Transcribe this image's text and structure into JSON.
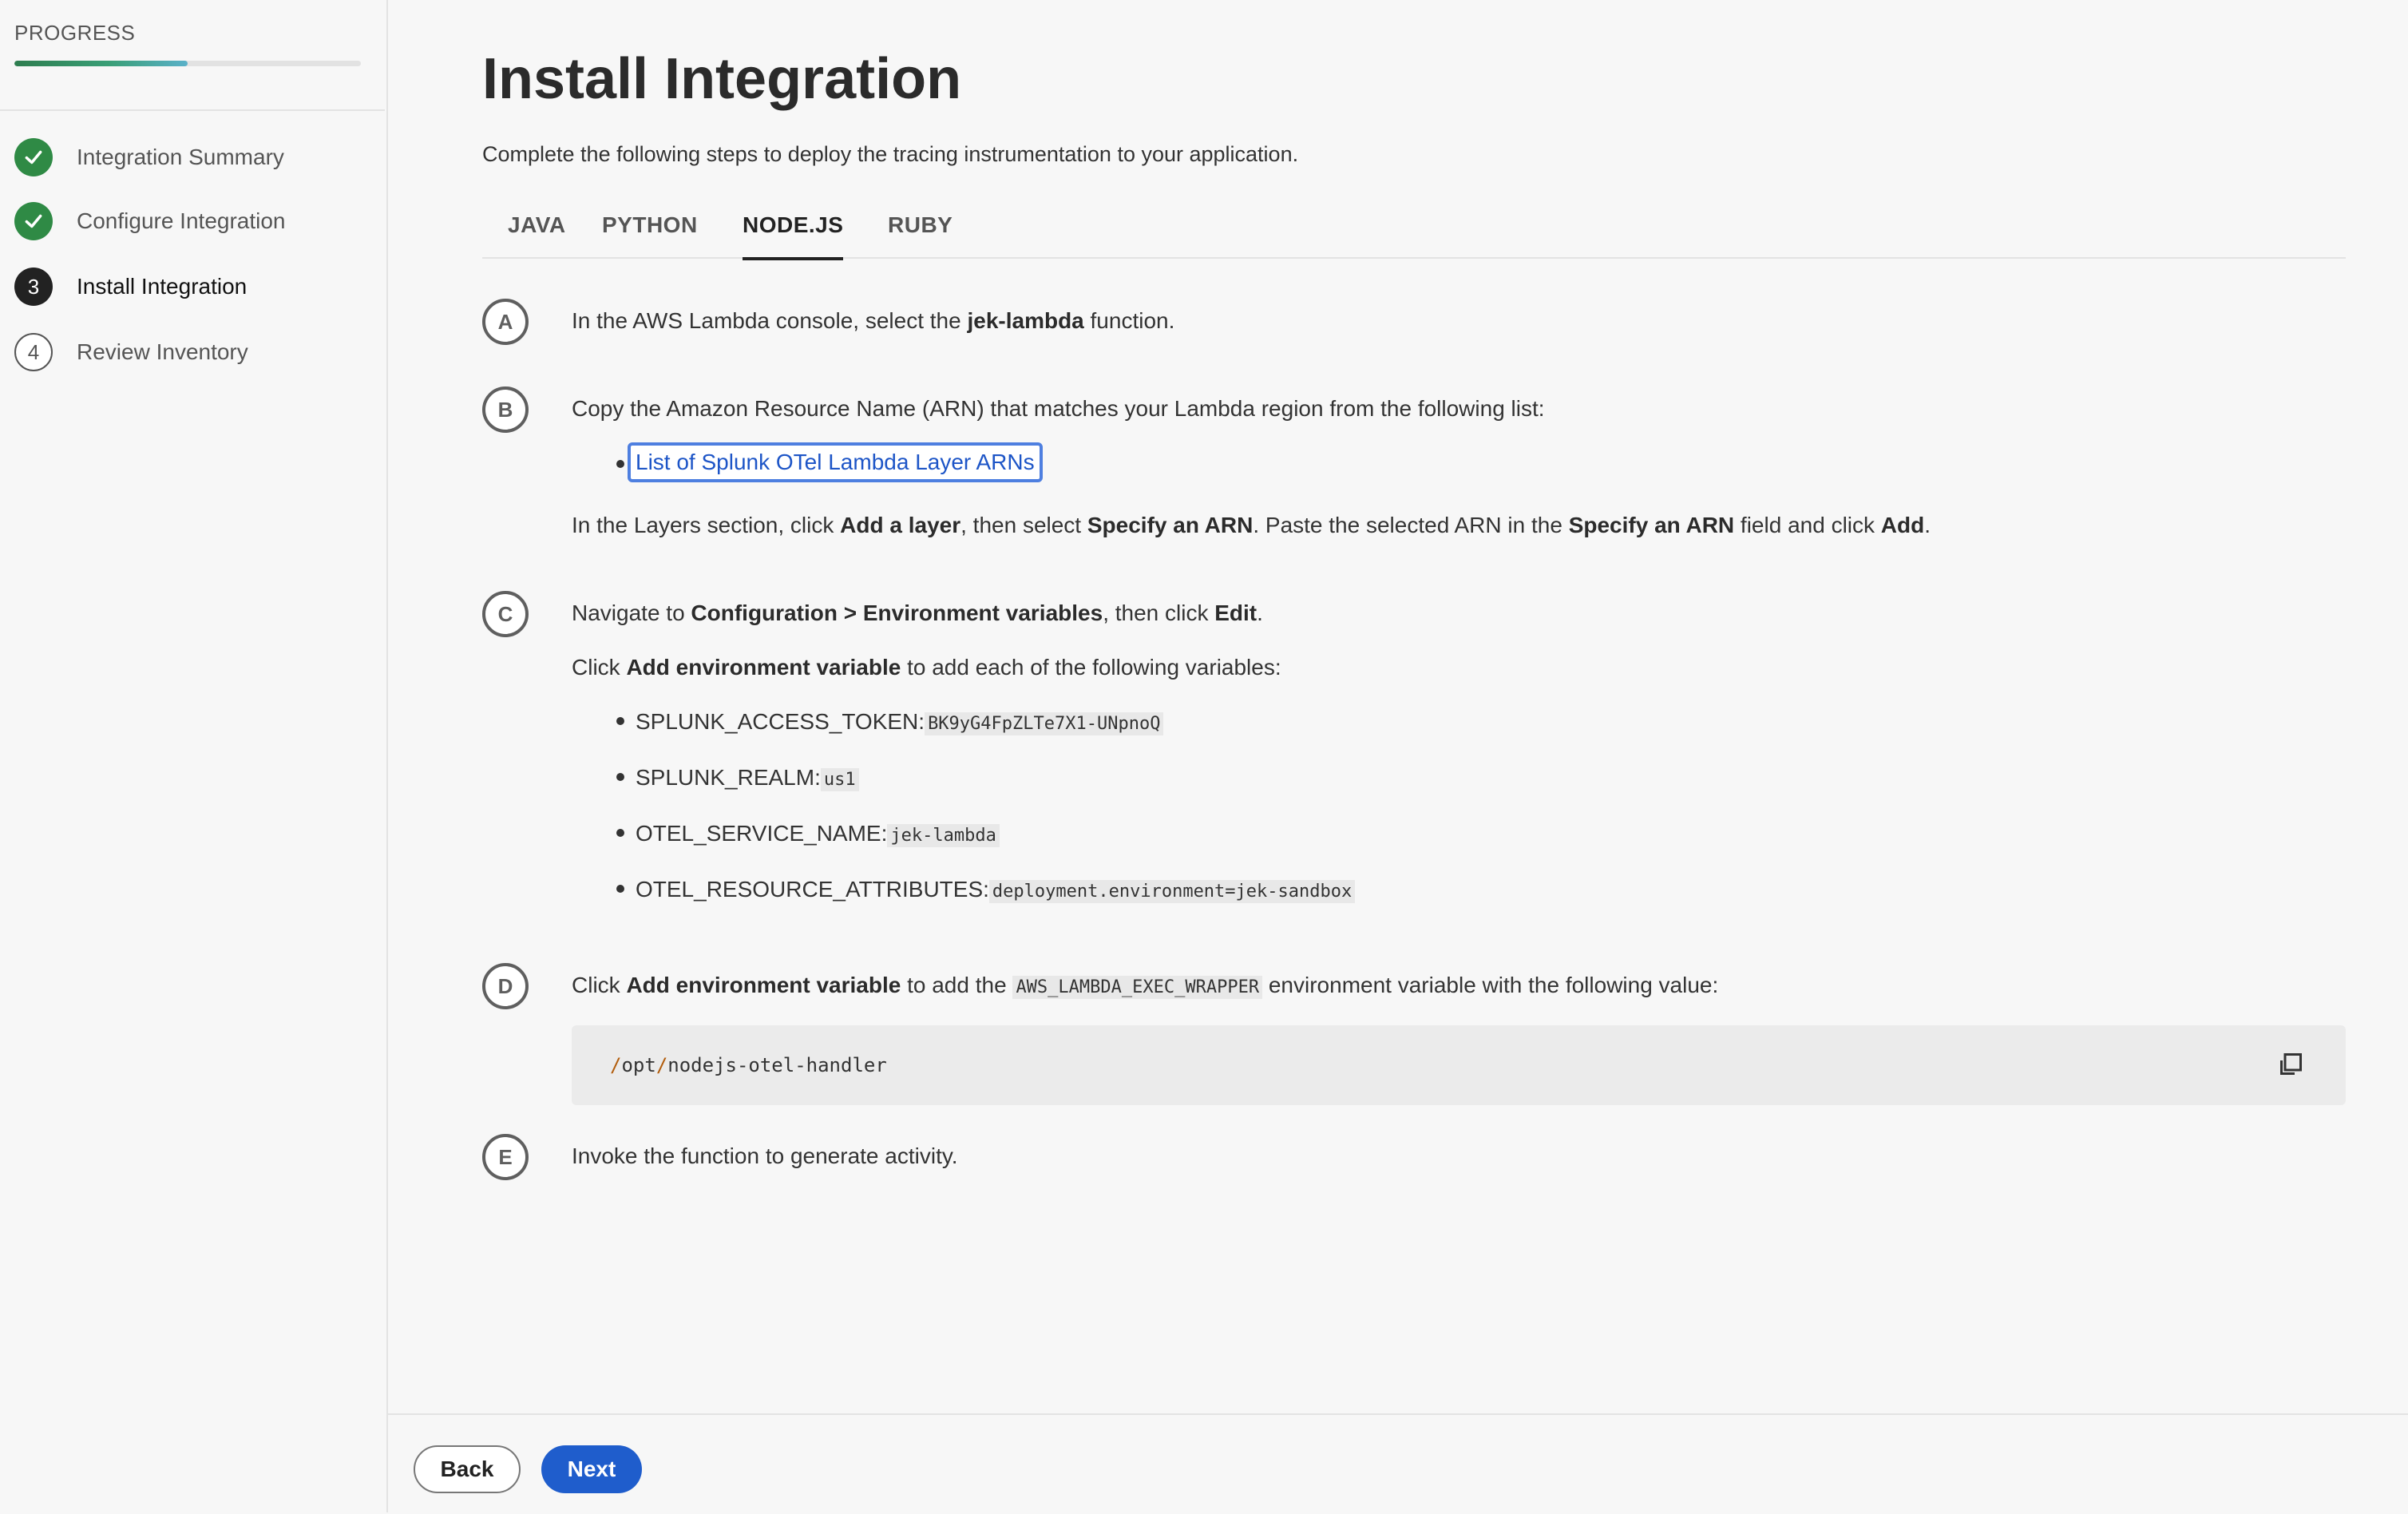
{
  "sidebar": {
    "progress_label": "PROGRESS",
    "progress_fraction": 0.5,
    "steps": [
      {
        "label": "Integration Summary",
        "state": "done"
      },
      {
        "label": "Configure Integration",
        "state": "done"
      },
      {
        "label": "Install Integration",
        "state": "current",
        "number": "3"
      },
      {
        "label": "Review Inventory",
        "state": "todo",
        "number": "4"
      }
    ]
  },
  "main": {
    "title": "Install Integration",
    "description": "Complete the following steps to deploy the tracing instrumentation to your application.",
    "tabs": [
      {
        "label": "JAVA",
        "active": false
      },
      {
        "label": "PYTHON",
        "active": false
      },
      {
        "label": "NODE.JS",
        "active": true
      },
      {
        "label": "RUBY",
        "active": false
      }
    ],
    "steps": {
      "a": {
        "letter": "A",
        "pre": "In the AWS Lambda console, select the ",
        "bold": "jek-lambda",
        "post": " function."
      },
      "b": {
        "letter": "B",
        "line1": "Copy the Amazon Resource Name (ARN) that matches your Lambda region from the following list:",
        "link": "List of Splunk OTel Lambda Layer ARNs",
        "line2": {
          "t1": "In the Layers section, click ",
          "b1": "Add a layer",
          "t2": ", then select ",
          "b2": "Specify an ARN",
          "t3": ". Paste the selected ARN in the ",
          "b3": "Specify an ARN",
          "t4": " field and click ",
          "b4": "Add",
          "t5": "."
        }
      },
      "c": {
        "letter": "C",
        "line1": {
          "t1": "Navigate to ",
          "b1": "Configuration > Environment variables",
          "t2": ", then click ",
          "b2": "Edit",
          "t3": "."
        },
        "line2": {
          "t1": "Click ",
          "b1": "Add environment variable",
          "t2": " to add each of the following variables:"
        },
        "variables": [
          {
            "name": "SPLUNK_ACCESS_TOKEN:",
            "value": "BK9yG4FpZLTe7X1-UNpnoQ"
          },
          {
            "name": "SPLUNK_REALM:",
            "value": "us1"
          },
          {
            "name": "OTEL_SERVICE_NAME:",
            "value": "jek-lambda"
          },
          {
            "name": "OTEL_RESOURCE_ATTRIBUTES:",
            "value": "deployment.environment=jek-sandbox"
          }
        ]
      },
      "d": {
        "letter": "D",
        "t1": "Click ",
        "b1": "Add environment variable",
        "t2": " to add the ",
        "code": "AWS_LAMBDA_EXEC_WRAPPER",
        "t3": " environment variable with the following value:",
        "block_parts": [
          "/",
          "opt",
          "/",
          "nodejs-otel-handler"
        ]
      },
      "e": {
        "letter": "E",
        "text": "Invoke the function to generate activity."
      }
    }
  },
  "footer": {
    "back_label": "Back",
    "next_label": "Next"
  }
}
